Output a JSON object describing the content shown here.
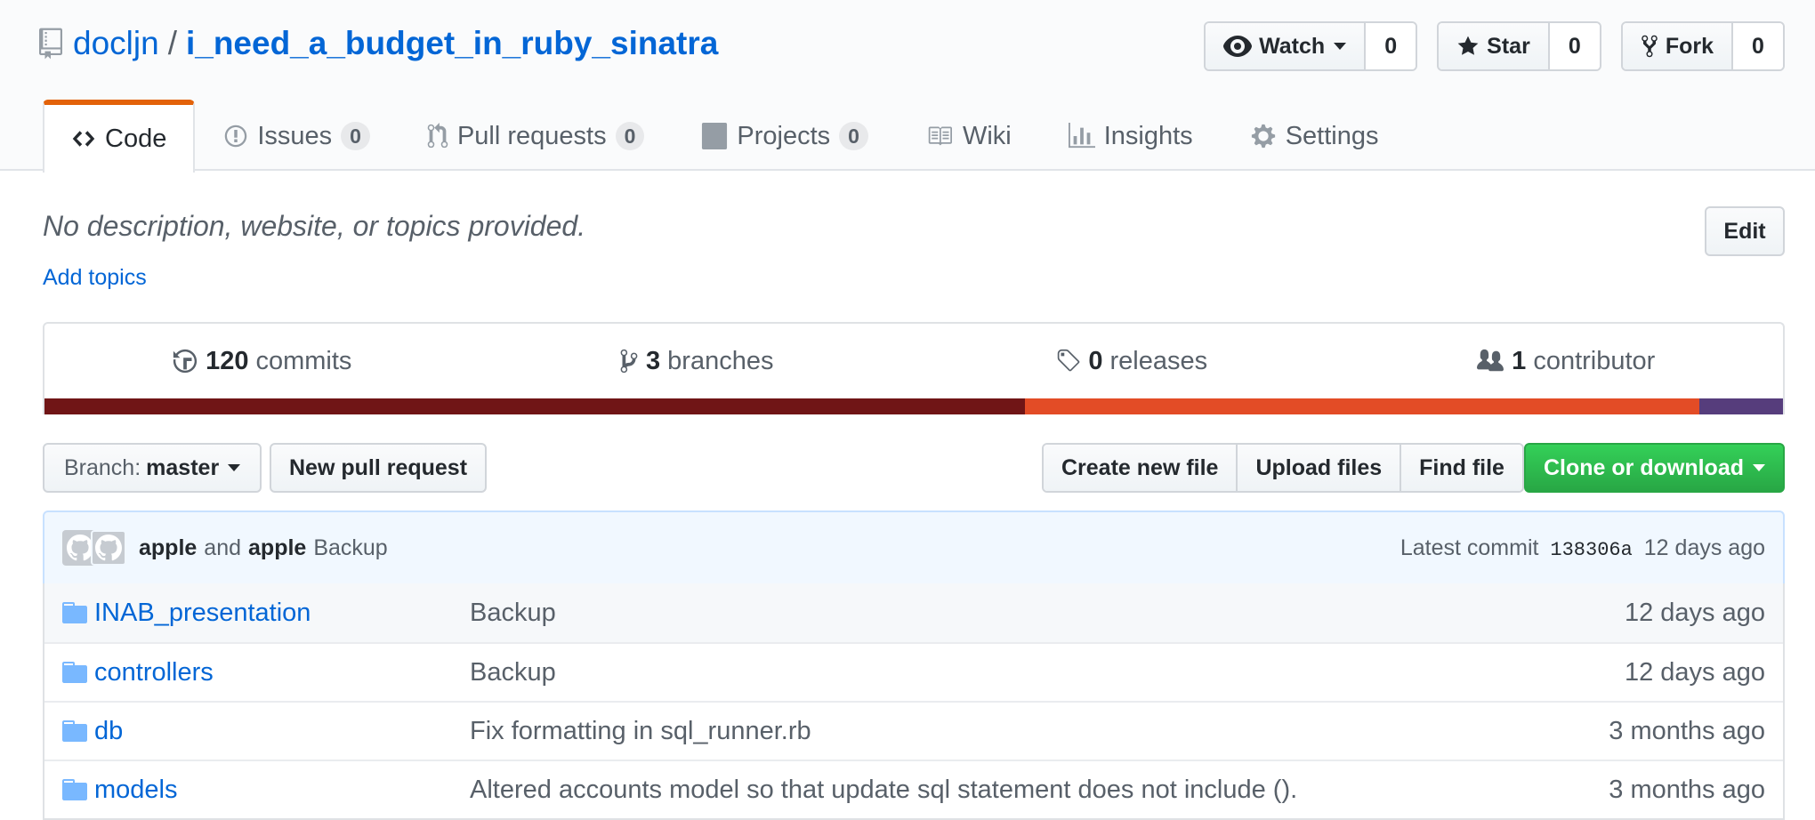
{
  "repo": {
    "owner": "docljn",
    "separator": "/",
    "name": "i_need_a_budget_in_ruby_sinatra"
  },
  "actions": {
    "watch": {
      "label": "Watch",
      "count": "0"
    },
    "star": {
      "label": "Star",
      "count": "0"
    },
    "fork": {
      "label": "Fork",
      "count": "0"
    }
  },
  "nav": {
    "code": "Code",
    "issues": {
      "label": "Issues",
      "count": "0"
    },
    "pulls": {
      "label": "Pull requests",
      "count": "0"
    },
    "projects": {
      "label": "Projects",
      "count": "0"
    },
    "wiki": "Wiki",
    "insights": "Insights",
    "settings": "Settings"
  },
  "description": {
    "text": "No description, website, or topics provided.",
    "add_topics": "Add topics",
    "edit": "Edit"
  },
  "summary": {
    "commits": {
      "count": "120",
      "label": "commits"
    },
    "branches": {
      "count": "3",
      "label": "branches"
    },
    "releases": {
      "count": "0",
      "label": "releases"
    },
    "contributors": {
      "count": "1",
      "label": "contributor"
    }
  },
  "languages": [
    {
      "color": "#701516",
      "percent": 56.4
    },
    {
      "color": "#e34c26",
      "percent": 38.8
    },
    {
      "color": "#563d7c",
      "percent": 4.8
    }
  ],
  "file_nav": {
    "branch_prefix": "Branch:",
    "branch_name": "master",
    "new_pull_request": "New pull request",
    "create_new_file": "Create new file",
    "upload_files": "Upload files",
    "find_file": "Find file",
    "clone_or_download": "Clone or download"
  },
  "commit_tease": {
    "author1": "apple",
    "and": "and",
    "author2": "apple",
    "message": "Backup",
    "latest_label": "Latest commit",
    "sha": "138306a",
    "age": "12 days ago"
  },
  "files": [
    {
      "name": "INAB_presentation",
      "message": "Backup",
      "age": "12 days ago"
    },
    {
      "name": "controllers",
      "message": "Backup",
      "age": "12 days ago"
    },
    {
      "name": "db",
      "message": "Fix formatting in sql_runner.rb",
      "age": "3 months ago"
    },
    {
      "name": "models",
      "message": "Altered accounts model so that update sql statement does not include ().",
      "age": "3 months ago"
    }
  ]
}
